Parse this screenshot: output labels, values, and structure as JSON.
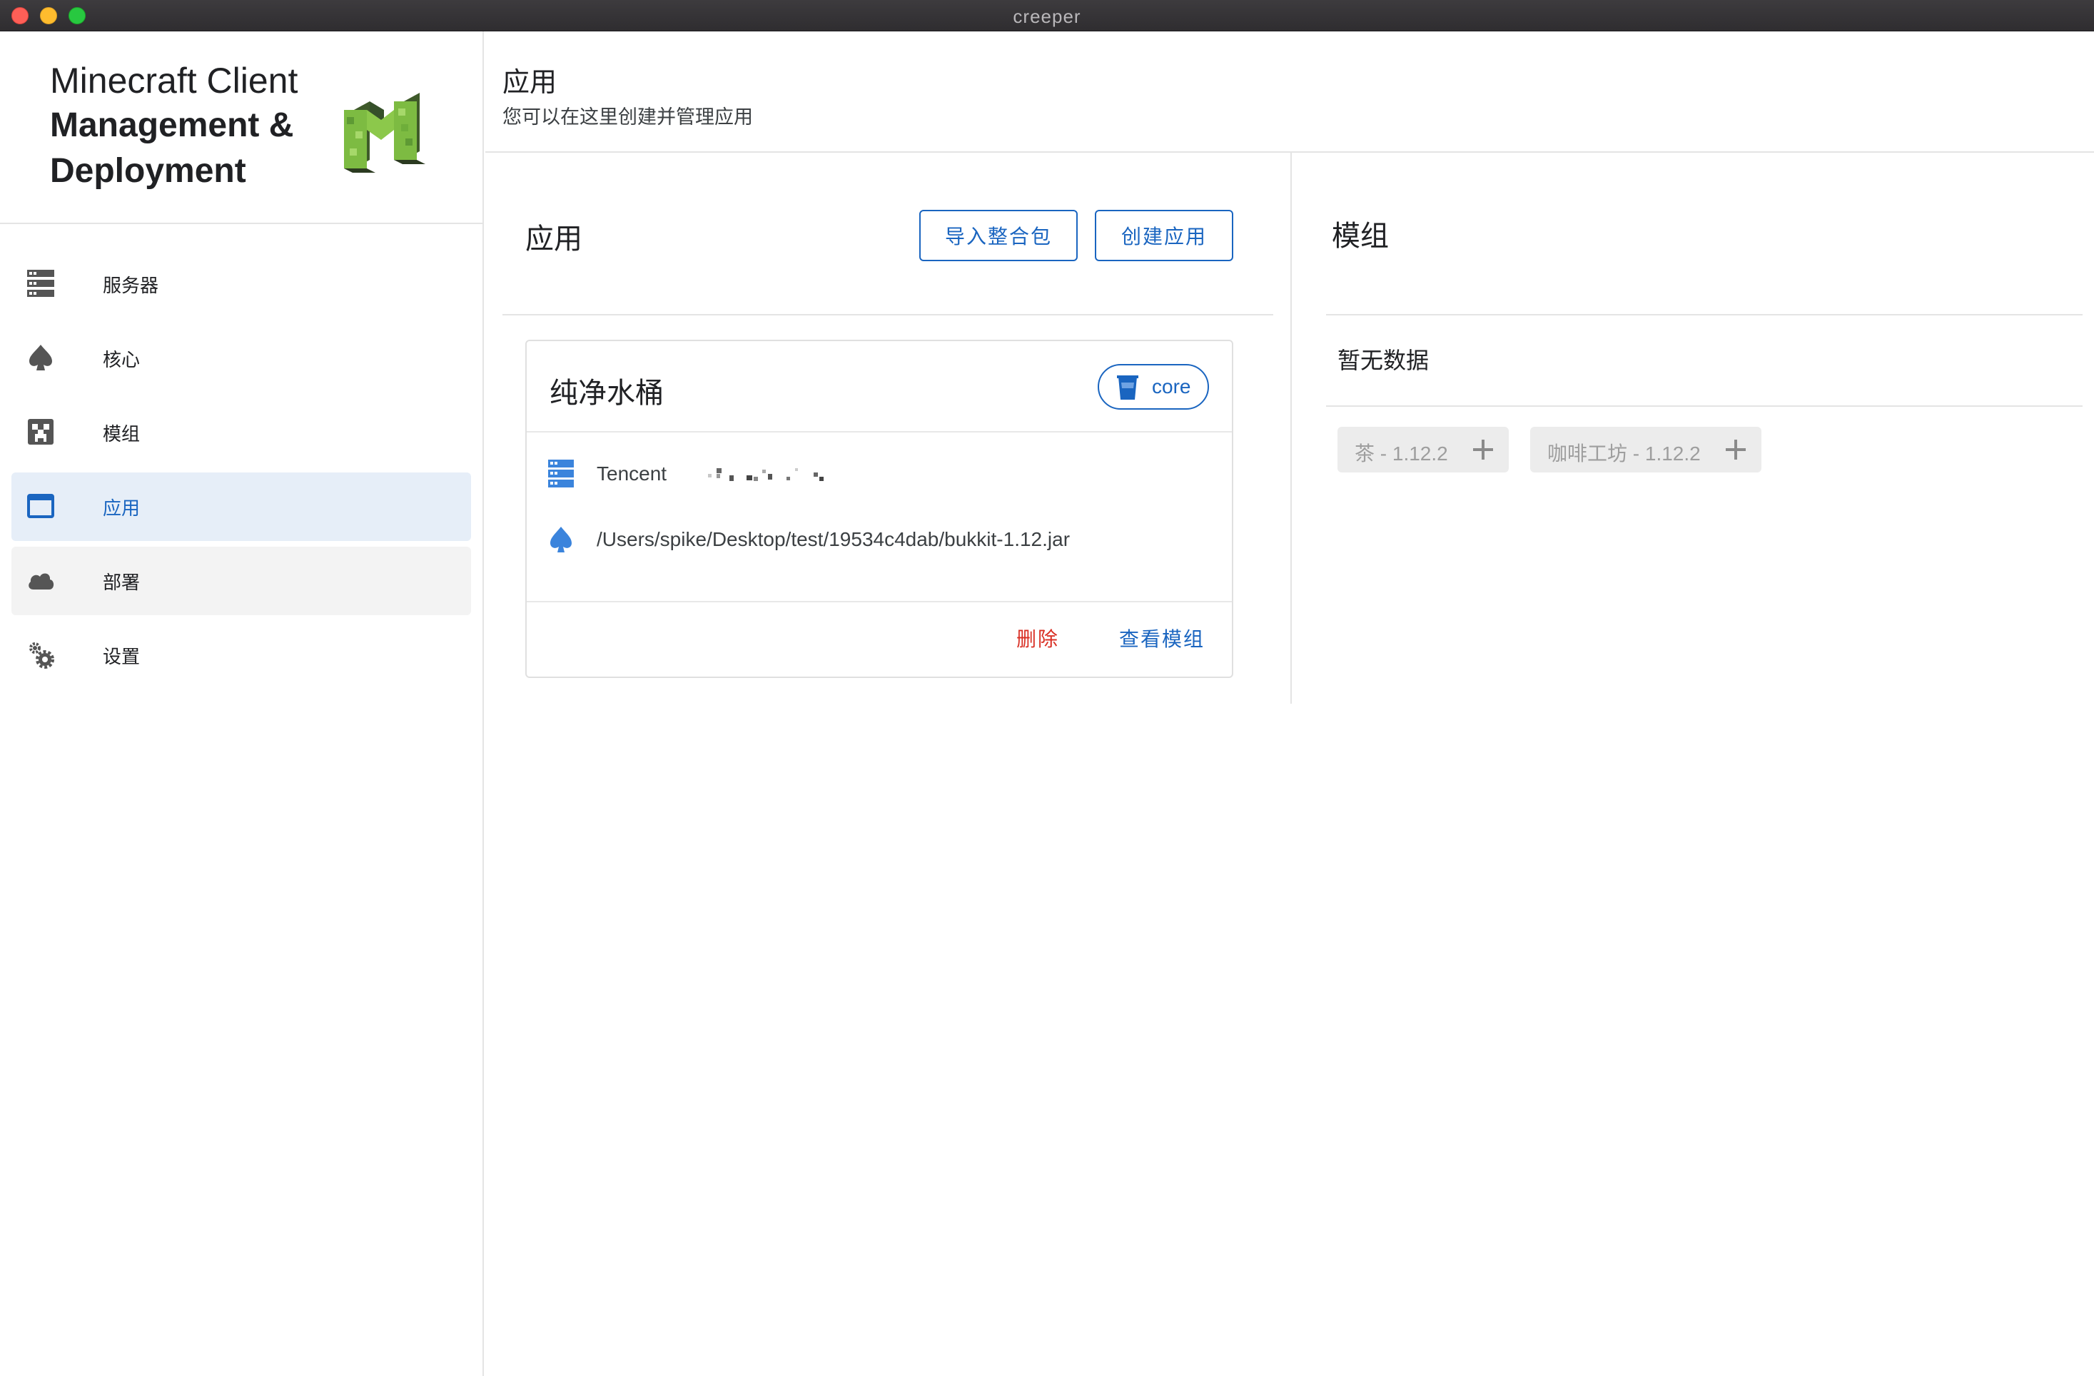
{
  "window": {
    "title": "creeper"
  },
  "brand": {
    "line1": "Minecraft Client",
    "line2": "Management &",
    "line3": "Deployment"
  },
  "sidebar": {
    "items": [
      {
        "label": "服务器",
        "icon": "server-icon"
      },
      {
        "label": "核心",
        "icon": "spade-icon"
      },
      {
        "label": "模组",
        "icon": "creeper-face-icon"
      },
      {
        "label": "应用",
        "icon": "window-icon",
        "active": true
      },
      {
        "label": "部署",
        "icon": "cloud-icon"
      },
      {
        "label": "设置",
        "icon": "gears-icon"
      }
    ]
  },
  "header": {
    "title": "应用",
    "subtitle": "您可以在这里创建并管理应用"
  },
  "apps": {
    "title": "应用",
    "import_label": "导入整合包",
    "create_label": "创建应用",
    "card": {
      "name": "纯净水桶",
      "core_chip": "core",
      "server": "Tencent",
      "core_path": "/Users/spike/Desktop/test/19534c4dab/bukkit-1.12.jar",
      "delete_label": "删除",
      "view_mods_label": "查看模组"
    }
  },
  "mods": {
    "title": "模组",
    "empty_text": "暂无数据",
    "available": [
      {
        "label": "茶 - 1.12.2"
      },
      {
        "label": "咖啡工坊 - 1.12.2"
      }
    ]
  },
  "colors": {
    "accent": "#1a65c0",
    "danger": "#d93025",
    "active_nav_bg": "#e6eef8"
  }
}
